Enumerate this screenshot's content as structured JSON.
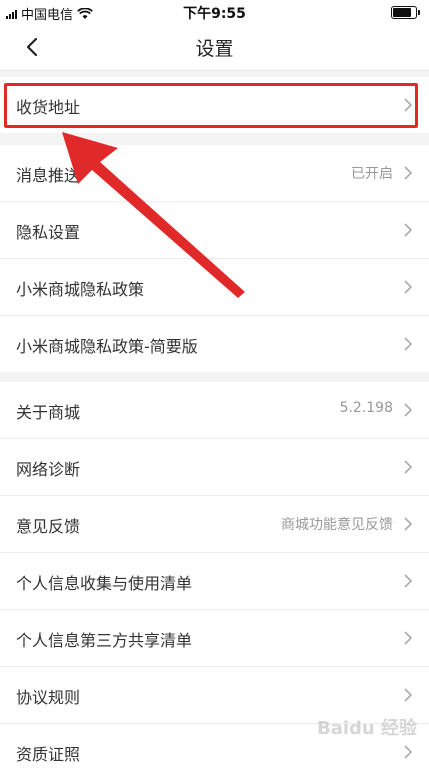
{
  "status_bar": {
    "carrier": "中国电信",
    "time": "下午9:55"
  },
  "header": {
    "title": "设置"
  },
  "group1": [
    {
      "label": "收货地址",
      "value": ""
    }
  ],
  "group2": [
    {
      "label": "消息推送",
      "value": "已开启"
    },
    {
      "label": "隐私设置",
      "value": ""
    },
    {
      "label": "小米商城隐私政策",
      "value": ""
    },
    {
      "label": "小米商城隐私政策-简要版",
      "value": ""
    }
  ],
  "group3": [
    {
      "label": "关于商城",
      "value": "5.2.198"
    },
    {
      "label": "网络诊断",
      "value": ""
    },
    {
      "label": "意见反馈",
      "value": "商城功能意见反馈"
    },
    {
      "label": "个人信息收集与使用清单",
      "value": ""
    },
    {
      "label": "个人信息第三方共享清单",
      "value": ""
    },
    {
      "label": "协议规则",
      "value": ""
    },
    {
      "label": "资质证照",
      "value": ""
    }
  ],
  "watermark": "Baidu 经验",
  "colors": {
    "highlight": "#e02a2a",
    "background": "#f4f4f4"
  }
}
